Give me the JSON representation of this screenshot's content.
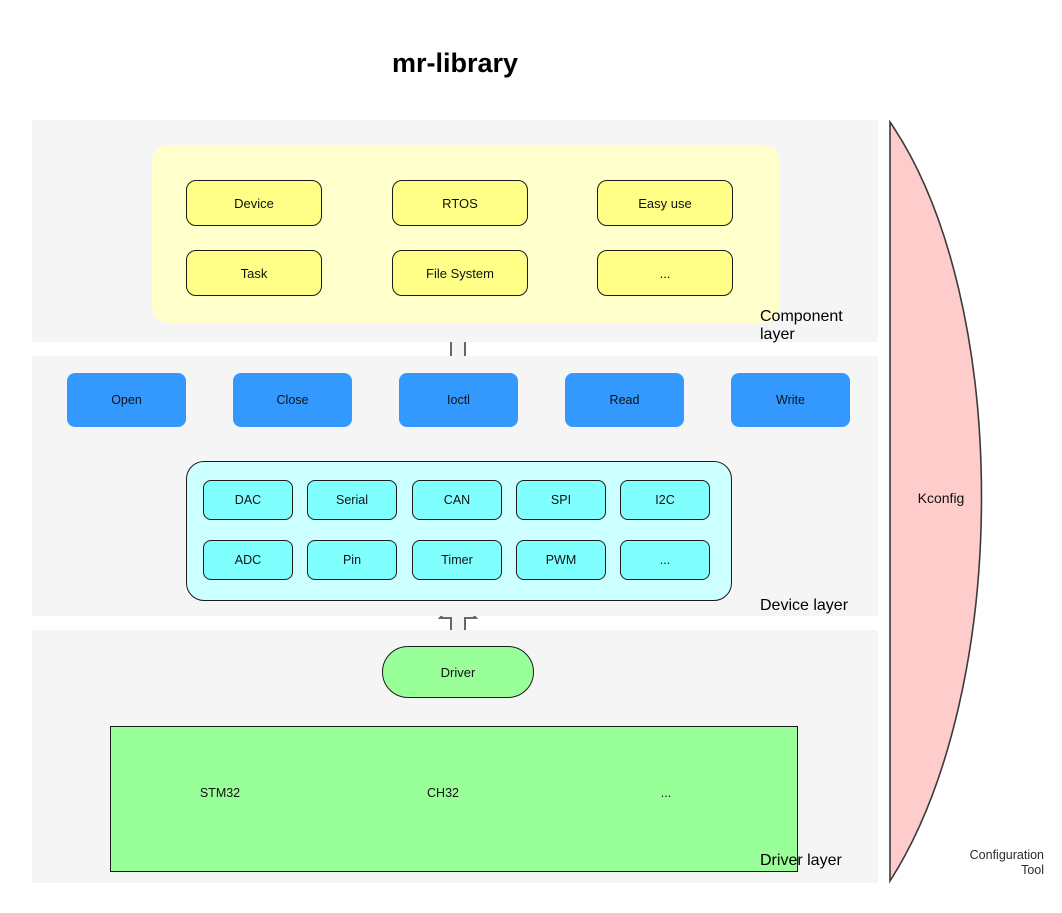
{
  "title": "mr-library",
  "layers": {
    "component": {
      "label": "Component\nlayer",
      "label_line1": "Component",
      "label_line2": "layer",
      "items": [
        {
          "label": "Device"
        },
        {
          "label": "RTOS"
        },
        {
          "label": "Easy use"
        },
        {
          "label": "Task"
        },
        {
          "label": "File System"
        },
        {
          "label": "..."
        }
      ]
    },
    "device": {
      "label": "Device layer",
      "api": [
        {
          "label": "Open"
        },
        {
          "label": "Close"
        },
        {
          "label": "Ioctl"
        },
        {
          "label": "Read"
        },
        {
          "label": "Write"
        }
      ],
      "peripherals": [
        {
          "label": "DAC"
        },
        {
          "label": "Serial"
        },
        {
          "label": "CAN"
        },
        {
          "label": "SPI"
        },
        {
          "label": "I2C"
        },
        {
          "label": "ADC"
        },
        {
          "label": "Pin"
        },
        {
          "label": "Timer"
        },
        {
          "label": "PWM"
        },
        {
          "label": "..."
        }
      ]
    },
    "driver": {
      "label": "Driver layer",
      "node": {
        "label": "Driver"
      },
      "boards": [
        {
          "label": "STM32"
        },
        {
          "label": "CH32"
        },
        {
          "label": "..."
        }
      ]
    }
  },
  "config_tool": {
    "label": "Kconfig",
    "caption_line1": "Configuration",
    "caption_line2": "Tool"
  },
  "colors": {
    "panel_bg": "#f5f5f5",
    "component_group": "#ffffcc",
    "component_box": "#ffff88",
    "api_box": "#3399ff",
    "device_group": "#ccffff",
    "device_box": "#80ffff",
    "driver_green": "#99ff99",
    "kconfig_pink": "#ffcccc",
    "stroke": "#1a1a1a",
    "arrow_gray": "#666666"
  }
}
